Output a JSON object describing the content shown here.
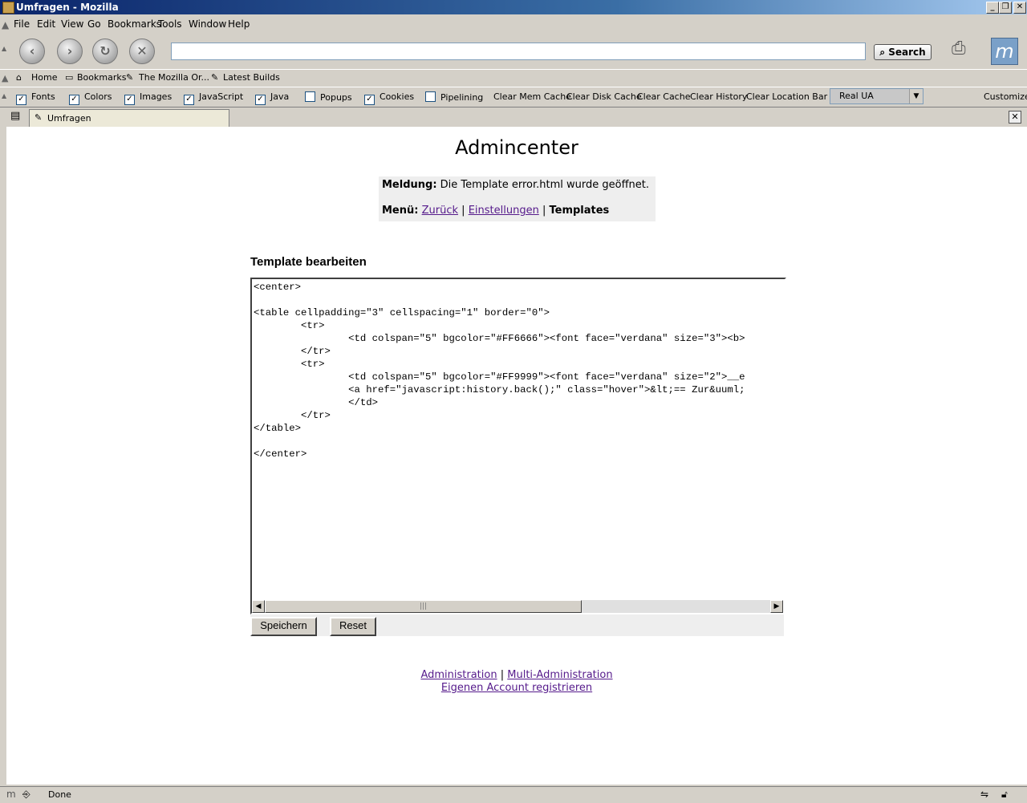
{
  "window": {
    "title": "Umfragen - Mozilla"
  },
  "menu": [
    "File",
    "Edit",
    "View",
    "Go",
    "Bookmarks",
    "Tools",
    "Window",
    "Help"
  ],
  "nav": {
    "search_label": "Search",
    "url_value": ""
  },
  "bookmarks": [
    "Home",
    "Bookmarks",
    "The Mozilla Or...",
    "Latest Builds"
  ],
  "prefbar": {
    "checks": [
      {
        "label": "Fonts",
        "checked": "✓"
      },
      {
        "label": "Colors",
        "checked": "✓"
      },
      {
        "label": "Images",
        "checked": "✓"
      },
      {
        "label": "JavaScript",
        "checked": "✓"
      },
      {
        "label": "Java",
        "checked": "✓"
      },
      {
        "label": "Popups",
        "checked": ""
      },
      {
        "label": "Cookies",
        "checked": "✓"
      },
      {
        "label": "Pipelining",
        "checked": ""
      }
    ],
    "buttons": [
      "Clear Mem Cache",
      "Clear Disk Cache",
      "Clear Cache",
      "Clear History",
      "Clear Location Bar"
    ],
    "ua_select": "Real UA",
    "customize": "Customize"
  },
  "tab": {
    "label": "Umfragen"
  },
  "page": {
    "heading": "Admincenter",
    "message_label": "Meldung:",
    "message_text": "Die Template error.html wurde geöffnet.",
    "menu_label": "Menü:",
    "menu_links": [
      "Zurück",
      "Einstellungen"
    ],
    "menu_sep": "|",
    "menu_current": "Templates",
    "section_title": "Template bearbeiten",
    "template_code": "<center>\n\n<table cellpadding=\"3\" cellspacing=\"1\" border=\"0\">\n        <tr>\n                <td colspan=\"5\" bgcolor=\"#FF6666\"><font face=\"verdana\" size=\"3\"><b>\n        </tr>\n        <tr>\n                <td colspan=\"5\" bgcolor=\"#FF9999\"><font face=\"verdana\" size=\"2\">__e\n                <a href=\"javascript:history.back();\" class=\"hover\">&lt;== Zur&uuml;\n                </td>\n        </tr>\n</table>\n\n</center>",
    "save_button": "Speichern",
    "reset_button": "Reset",
    "footer_links": [
      "Administration",
      "Multi-Administration",
      "Eigenen Account registrieren"
    ],
    "footer_sep": "|"
  },
  "status": {
    "text": "Done"
  }
}
